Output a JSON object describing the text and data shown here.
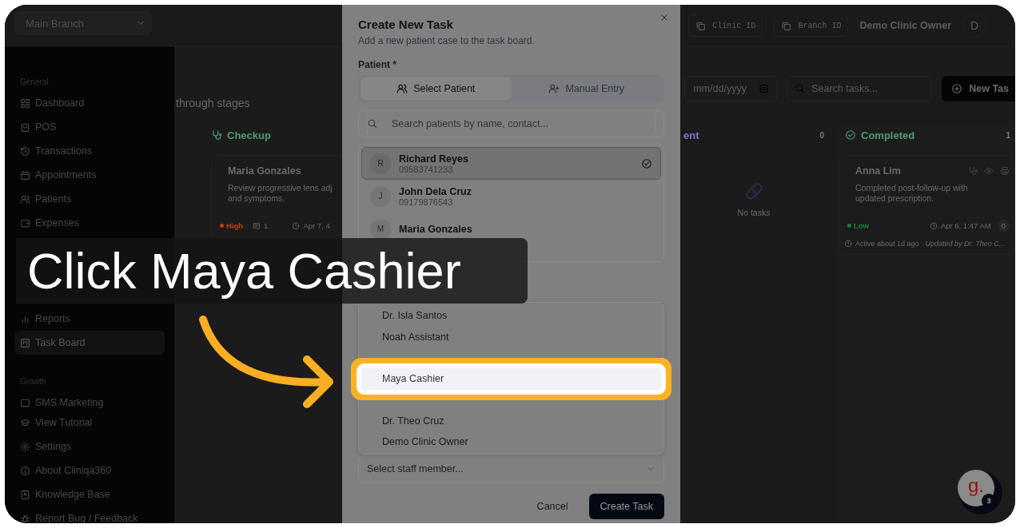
{
  "sidebar": {
    "branch_select": "Main Branch",
    "sections": [
      {
        "title": "General",
        "groups": [
          [
            {
              "label": "Dashboard",
              "selected": false
            },
            {
              "label": "POS",
              "selected": false
            },
            {
              "label": "Transactions",
              "selected": false
            },
            {
              "label": "Appointments",
              "selected": false
            },
            {
              "label": "Patients",
              "selected": false
            },
            {
              "label": "Expenses",
              "selected": false
            }
          ],
          [
            {
              "label": "Reports",
              "selected": false
            },
            {
              "label": "Task Board",
              "selected": true
            }
          ]
        ]
      },
      {
        "title": "Growth",
        "groups": [
          [
            {
              "label": "SMS Marketing",
              "selected": false
            }
          ]
        ]
      }
    ],
    "footer": [
      "View Tutorial",
      "Settings",
      "About Cliniqa360",
      "Knowledge Base",
      "Report Bug / Feedback"
    ]
  },
  "topbar": {
    "chips": [
      "Clinic ID",
      "Branch ID"
    ],
    "user": "Demo Clinic Owner",
    "avatar": "D"
  },
  "page": {
    "subtitle": "through stages",
    "date_field": {
      "placeholder": "mm/dd/yyyy"
    },
    "search": {
      "placeholder": "Search tasks..."
    },
    "new_button": "New Tas"
  },
  "columns": [
    {
      "kind": "checkup",
      "title": "Checkup",
      "cards": [
        {
          "name": "Maria Gonzales",
          "description": [
            "Review progressive lens adj",
            "and symptoms."
          ],
          "priority": "High",
          "color": "#c2410c",
          "comments": "1",
          "date": "Apr 7, 4"
        }
      ]
    },
    {
      "kind": "empty",
      "title": "ent",
      "count": "0",
      "empty_text": "No tasks"
    },
    {
      "kind": "completed",
      "title": "Completed",
      "count": "1",
      "cards": [
        {
          "name": "Anna Lim",
          "description": [
            "Completed post-follow-up with",
            "updated prescription."
          ],
          "priority": "Low",
          "color": "#15803d",
          "date": "Apr 6, 1:47 AM",
          "chip": "0",
          "active": "Active about 1d ago",
          "updated": "Updated by Dr. Theo C..."
        }
      ]
    }
  ],
  "modal": {
    "title": "Create New Task",
    "subtitle": "Add a new patient case to the task board.",
    "patient_label": "Patient *",
    "tabs": [
      {
        "label": "Select Patient",
        "selected": true
      },
      {
        "label": "Manual Entry",
        "selected": false
      }
    ],
    "patient_search": {
      "placeholder": "Search patients by name, contact..."
    },
    "patients": [
      {
        "initial": "R",
        "name": "Richard Reyes",
        "phone": "09583741233",
        "selected": true
      },
      {
        "initial": "J",
        "name": "John Dela Cruz",
        "phone": "09179876543",
        "selected": false
      },
      {
        "initial": "M",
        "name": "Maria Gonzales",
        "selected": false
      }
    ],
    "staff_options": [
      {
        "name": "Dr. Isla Santos",
        "highlighted": false
      },
      {
        "name": "Noah Assistant",
        "highlighted": false
      },
      {
        "name": "Maya Cashier",
        "highlighted": true
      },
      {
        "name": "Dr. Theo Cruz",
        "highlighted": false
      },
      {
        "name": "Demo Clinic Owner",
        "highlighted": false
      }
    ],
    "staff_select": {
      "placeholder": "Select staff member..."
    },
    "buttons": [
      "Cancel",
      "Create Task"
    ]
  },
  "callout": "Click Maya Cashier",
  "help_button": {
    "logo": "g.",
    "badge": "3"
  }
}
